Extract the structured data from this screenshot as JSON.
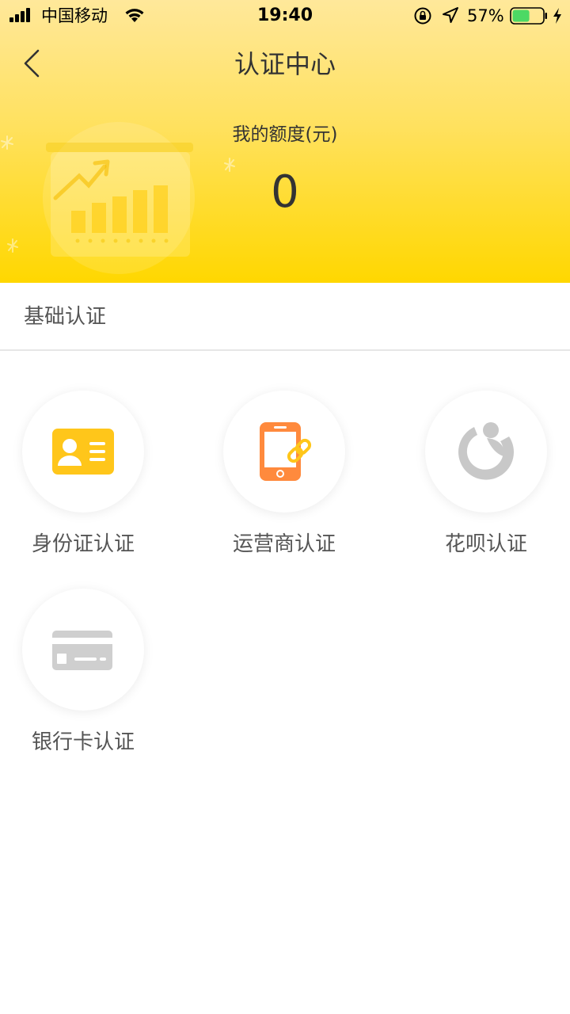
{
  "status_bar": {
    "carrier": "中国移动",
    "time": "19:40",
    "battery_percent": "57%",
    "battery_level": 0.57,
    "battery_color": "#4cd964",
    "icons": [
      "signal-icon",
      "wifi-icon",
      "rotation-lock-icon",
      "location-arrow-icon",
      "battery-icon",
      "charging-bolt-icon"
    ]
  },
  "nav": {
    "title": "认证中心",
    "back_icon": "chevron-left-icon"
  },
  "quota": {
    "label": "我的额度(元)",
    "value": "0"
  },
  "section": {
    "title": "基础认证"
  },
  "auth_items": [
    {
      "label": "身份证认证",
      "icon": "id-card-icon",
      "color": "#ffc61a"
    },
    {
      "label": "运营商认证",
      "icon": "phone-link-icon",
      "color": "#ff8a3d"
    },
    {
      "label": "花呗认证",
      "icon": "huabei-icon",
      "color": "#c8c8c8"
    },
    {
      "label": "银行卡认证",
      "icon": "bank-card-icon",
      "color": "#cfcfcf"
    }
  ],
  "colors": {
    "header_gradient_top": "#ffe89a",
    "header_gradient_bottom": "#ffd700",
    "text_primary": "#333333",
    "text_secondary": "#555555"
  }
}
